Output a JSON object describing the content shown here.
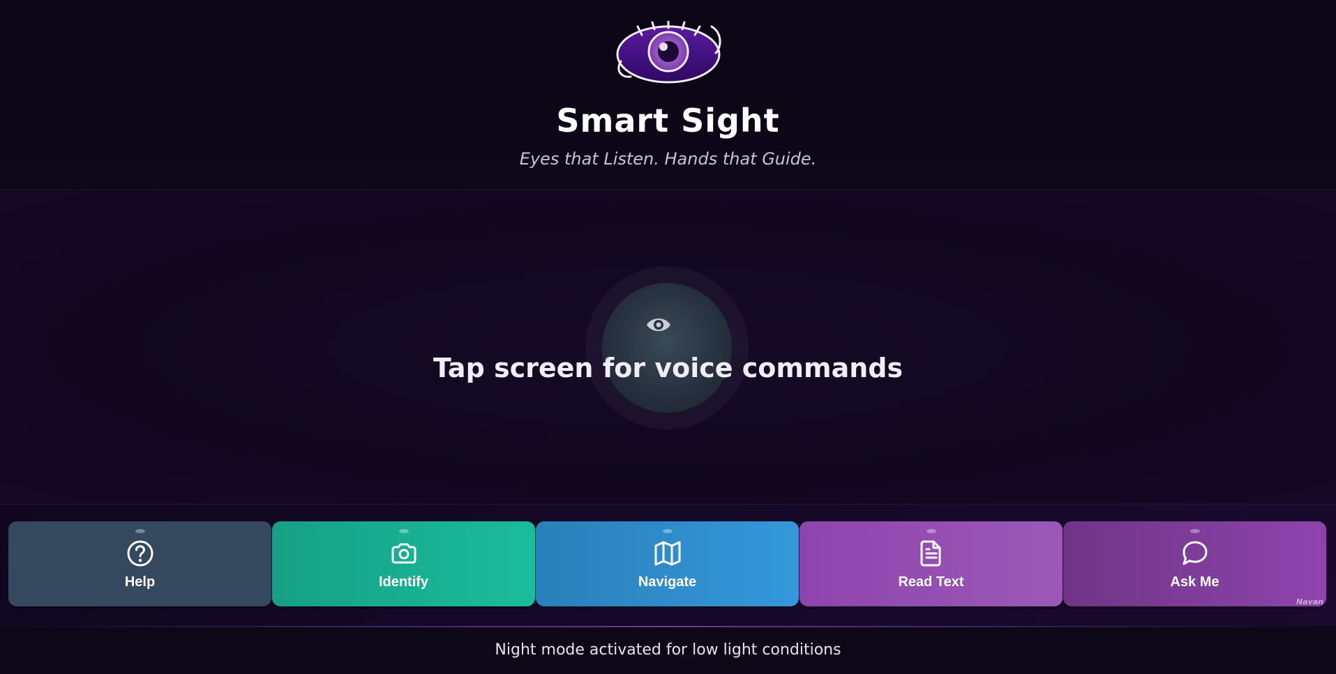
{
  "header": {
    "title": "Smart Sight",
    "tagline": "Eyes that Listen. Hands that Guide.",
    "logo_icon": "eye-logo-icon"
  },
  "main": {
    "prompt": "Tap screen for voice commands",
    "center_icon": "eye-icon"
  },
  "controls": [
    {
      "label": "Help",
      "icon": "help-circle-icon",
      "color": "#34495e"
    },
    {
      "label": "Identify",
      "icon": "camera-icon",
      "color": "#1abc9c"
    },
    {
      "label": "Navigate",
      "icon": "map-icon",
      "color": "#3498db"
    },
    {
      "label": "Read Text",
      "icon": "document-icon",
      "color": "#9b59b6"
    },
    {
      "label": "Ask Me",
      "icon": "chat-bubble-icon",
      "color": "#8e44ad"
    }
  ],
  "watermark": "Navan",
  "footer": {
    "status": "Night mode activated for low light conditions"
  }
}
